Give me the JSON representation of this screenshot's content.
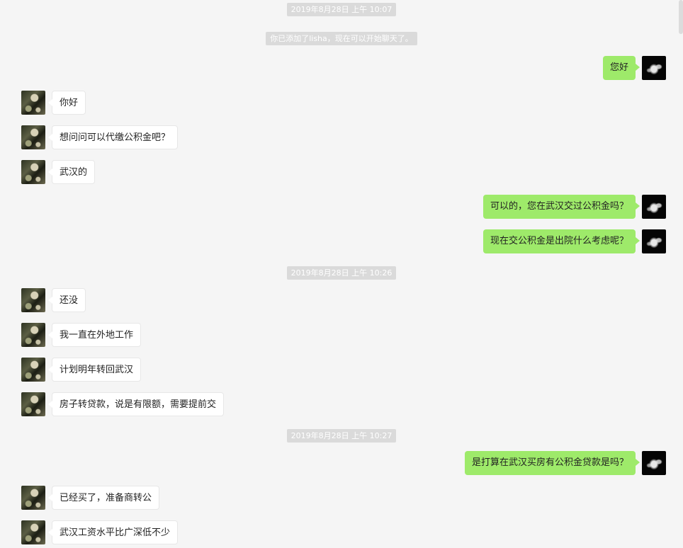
{
  "timestamps": {
    "t1": "2019年8月28日 上午 10:07",
    "t2": "2019年8月28日 上午 10:26",
    "t3": "2019年8月28日 上午 10:27"
  },
  "system_notice": "你已添加了lisha，现在可以开始聊天了。",
  "messages": [
    {
      "side": "right",
      "text": "您好"
    },
    {
      "side": "left",
      "text": "你好"
    },
    {
      "side": "left",
      "text": "想问问可以代缴公积金吧？"
    },
    {
      "side": "left",
      "text": "武汉的"
    },
    {
      "side": "right",
      "text": "可以的，您在武汉交过公积金吗？"
    },
    {
      "side": "right",
      "text": "现在交公积金是出院什么考虑呢？"
    },
    {
      "side": "left",
      "text": "还没"
    },
    {
      "side": "left",
      "text": "我一直在外地工作"
    },
    {
      "side": "left",
      "text": "计划明年转回武汉"
    },
    {
      "side": "left",
      "text": "房子转贷款，说是有限额，需要提前交"
    },
    {
      "side": "right",
      "text": "是打算在武汉买房有公积金贷款是吗？"
    },
    {
      "side": "left",
      "text": "已经买了，准备商转公"
    },
    {
      "side": "left",
      "text": "武汉工资水平比广深低不少"
    }
  ]
}
